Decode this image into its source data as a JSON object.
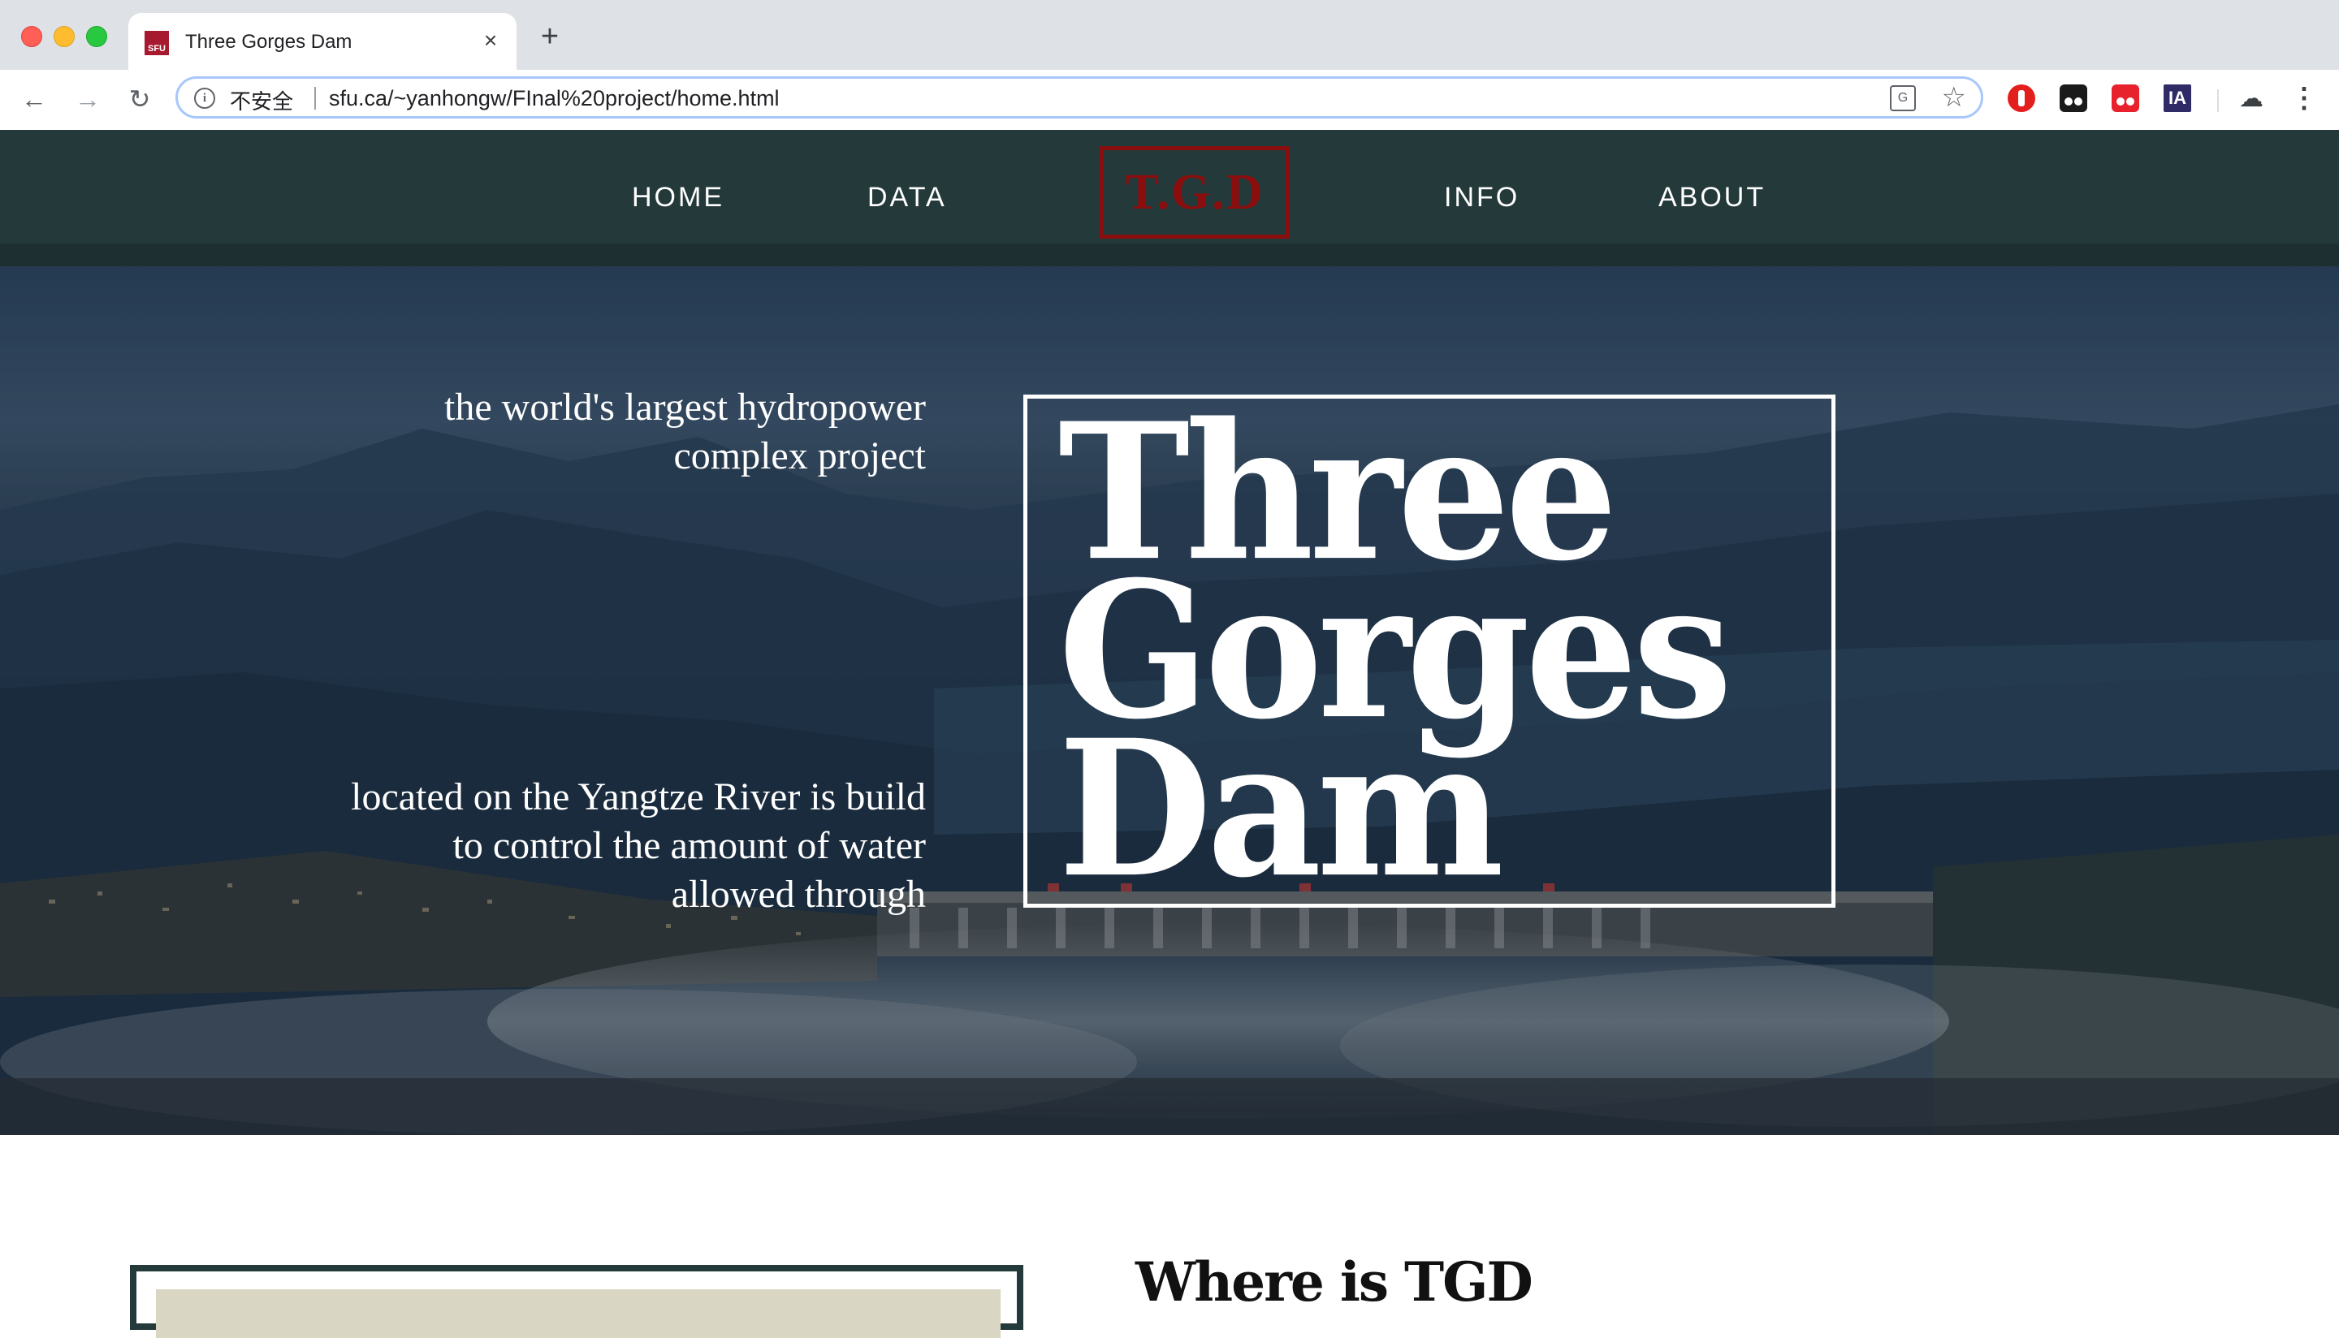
{
  "browser": {
    "tab_title": "Three Gorges Dam",
    "favicon_text": "SFU",
    "tab_close": "×",
    "new_tab": "+",
    "back": "←",
    "forward": "→",
    "reload": "↻",
    "info_glyph": "i",
    "security_label": "不安全",
    "url": "sfu.ca/~yanhongw/FInal%20project/home.html",
    "translate_glyph": "G",
    "bookmark_glyph": "☆",
    "ia_label": "IA",
    "profile_glyph": "☁",
    "menu_glyph": "⋮",
    "icons": [
      "info-icon",
      "translate-icon",
      "star-icon",
      "adblock-icon",
      "tampermonkey-icon",
      "extension-icon",
      "internet-archive-icon",
      "profile-icon",
      "menu-icon"
    ]
  },
  "site": {
    "nav": {
      "home": "HOME",
      "data": "DATA",
      "logo": "T.G.D",
      "info": "INFO",
      "about": "ABOUT"
    },
    "hero": {
      "tagline_top": "the world's largest hydropower complex project",
      "tagline_bottom": "located on the Yangtze River is build to control the amount of water allowed through",
      "title_line1": "Three",
      "title_line2": "Gorges",
      "title_line3": "Dam"
    },
    "section": {
      "heading": "Where is TGD"
    },
    "colors": {
      "header_bg": "#24393a",
      "logo_red": "#8b0e0e",
      "text_white": "#ffffff"
    }
  }
}
